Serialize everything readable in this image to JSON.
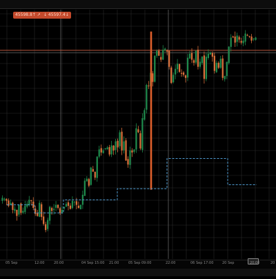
{
  "price_tags": [
    {
      "text": "45598.8↑ ↗",
      "icon": "arrow-up-icon"
    },
    {
      "text": "↓ 45597.4↓",
      "icon": "arrow-down-icon"
    }
  ],
  "colors": {
    "background": "#000000",
    "grid": "#2b2b2b",
    "vgrid_marker": "#5a5a5a",
    "candle_up": "#1f8a4c",
    "candle_down": "#d9703a",
    "big_candle": "#e0602c",
    "hline": "#c8553a",
    "hline2": "#7a7a7a",
    "stepline": "#4f9bd0",
    "tag_bg": "#c44a2c"
  },
  "chart_data": {
    "type": "candlestick",
    "x_tick_labels": [
      "05 Sep",
      "12:00",
      "20:00",
      "04 Sep 15:00",
      "21:00",
      "05 Sep 09:00",
      "22:00",
      "06 Sep 17:00",
      "20 Sep",
      "20:00",
      "20"
    ],
    "close_series_y_scale": "0-100 (relative price)",
    "closes": [
      47,
      46,
      44,
      39,
      42,
      35,
      36,
      29,
      40,
      32,
      34,
      39,
      41,
      45,
      44,
      37,
      31,
      29,
      42,
      28,
      21,
      15,
      25,
      38,
      34,
      36,
      40,
      37,
      32,
      35,
      38,
      41,
      39,
      36,
      44,
      43,
      40,
      37,
      40,
      50,
      64,
      66,
      59,
      77,
      73,
      67,
      88,
      95,
      92,
      94,
      96,
      97,
      90,
      99,
      94,
      103,
      97,
      112,
      94,
      103,
      84,
      80,
      94,
      92,
      95,
      116,
      112,
      96,
      126,
      134,
      159,
      158,
      171,
      162,
      188,
      193,
      188,
      184,
      194,
      195,
      192,
      177,
      161,
      169,
      175,
      180,
      172,
      170,
      169,
      166,
      186,
      190,
      184,
      181,
      193,
      177,
      182,
      187,
      165,
      187,
      190,
      191,
      187,
      173,
      181,
      176,
      185,
      166,
      168,
      182,
      197,
      206,
      206,
      201,
      208,
      204,
      201,
      203,
      210,
      208,
      207,
      203,
      205,
      206
    ],
    "stepline_levels": [
      40,
      40,
      32,
      32,
      32,
      45,
      45,
      45,
      45,
      56,
      56,
      56,
      56,
      86,
      86,
      60,
      60
    ],
    "h_levels": [
      193.4,
      191.0
    ]
  }
}
